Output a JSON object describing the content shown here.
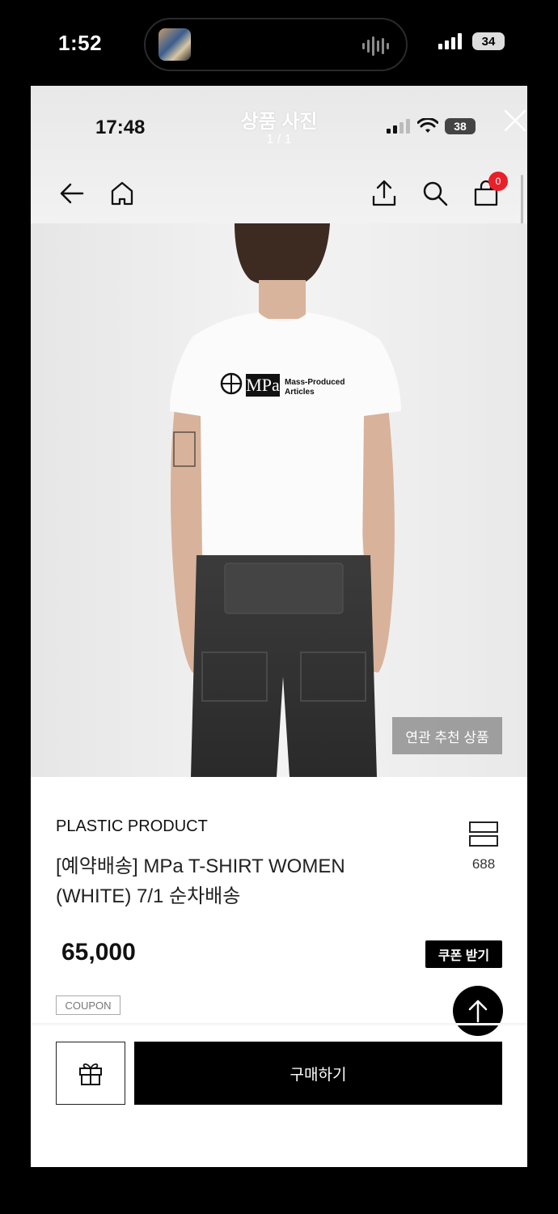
{
  "os_status": {
    "time": "1:52",
    "battery": "34"
  },
  "viewer": {
    "inner_time": "17:48",
    "title": "상품 사진",
    "counter": "1 / 1",
    "inner_battery": "38",
    "cart_count": "0"
  },
  "photo": {
    "shirt_logo_text": "MPa",
    "shirt_text_line1": "Mass-Produced",
    "shirt_text_line2": "Articles",
    "related_label": "연관 추천 상품"
  },
  "product": {
    "brand": "PLASTIC PRODUCT",
    "name": "[예약배송]  MPa T-SHIRT WOMEN (WHITE) 7/1 순차배송",
    "like_count": "688",
    "price": "65,000",
    "coupon_button_label": "쿠폰 받기",
    "coupon_tag": "COUPON",
    "buy_label": "구매하기"
  },
  "icons": [
    "back-arrow-icon",
    "home-icon",
    "share-icon",
    "search-icon",
    "cart-icon",
    "close-icon",
    "like-icon",
    "arrow-up-icon",
    "gift-icon"
  ]
}
